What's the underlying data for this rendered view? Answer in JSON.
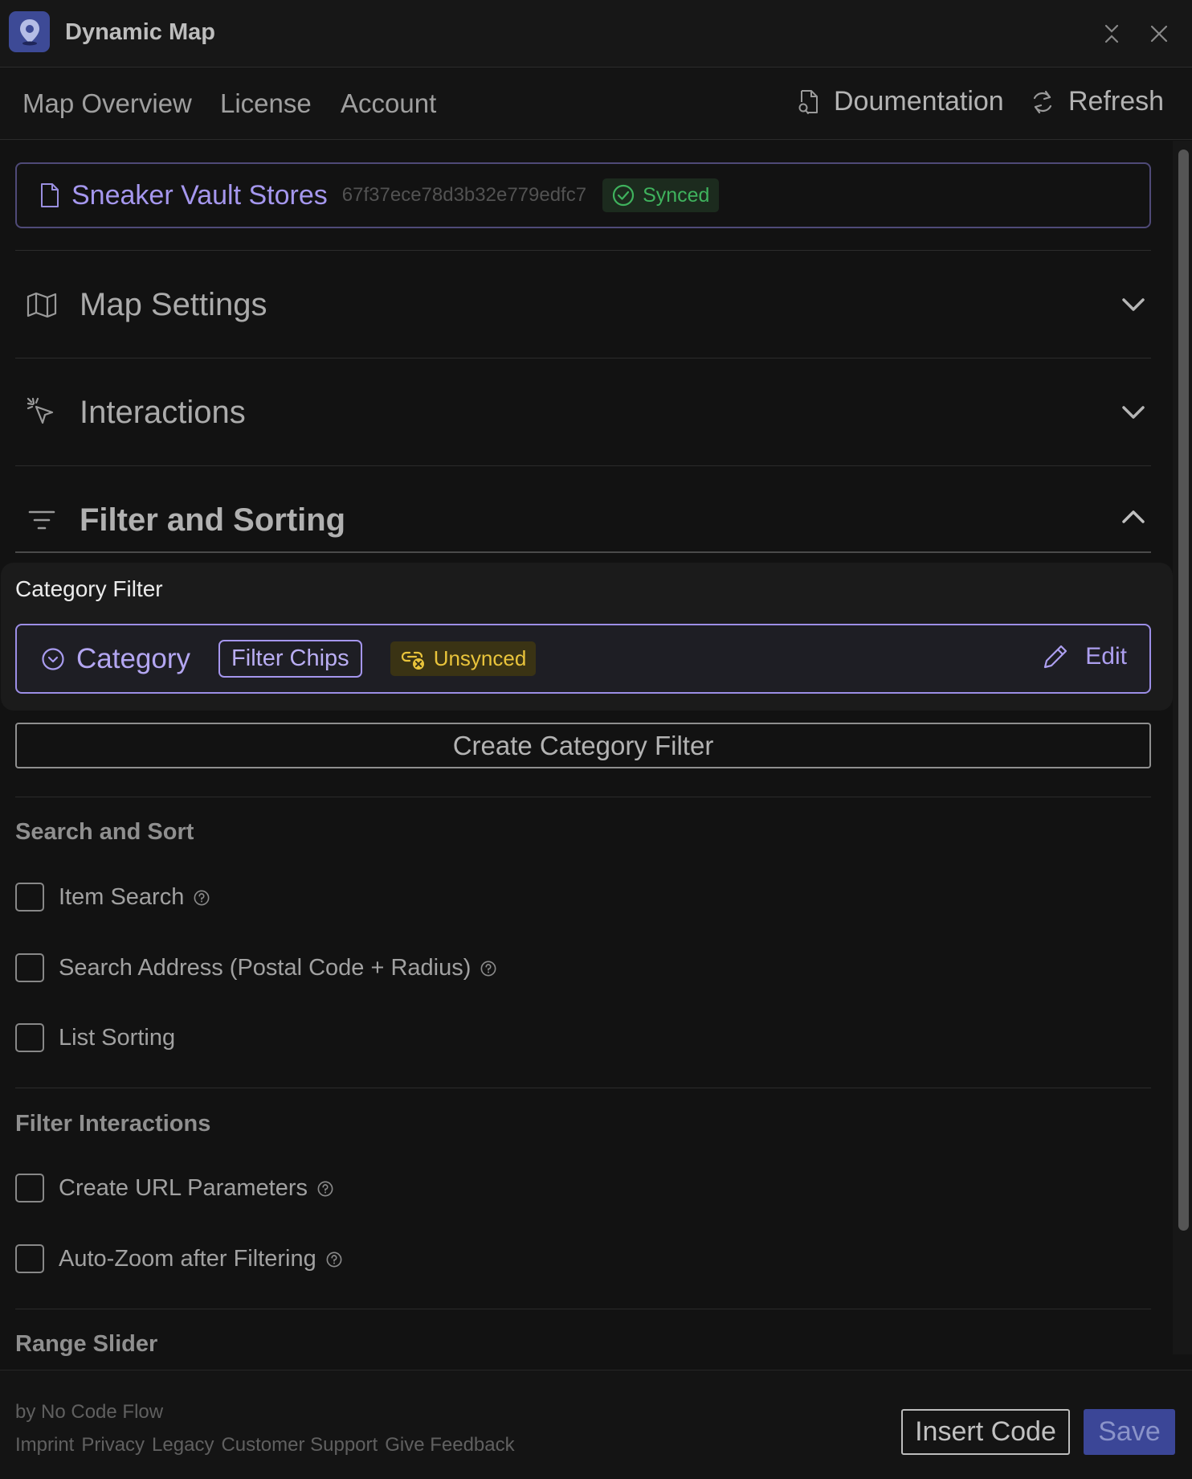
{
  "app": {
    "title": "Dynamic Map",
    "icon": "map-pin-icon",
    "accent_color": "#3d4a96"
  },
  "nav": {
    "tabs": [
      {
        "label": "Map Overview"
      },
      {
        "label": "License"
      },
      {
        "label": "Account"
      }
    ],
    "documentation_label": "Doumentation",
    "refresh_label": "Refresh"
  },
  "item": {
    "name": "Sneaker Vault Stores",
    "id": "67f37ece78d3b32e779edfc7",
    "status": "Synced",
    "status_color": "#3fb25d"
  },
  "accordions": {
    "map_settings": {
      "title": "Map Settings",
      "state": "collapsed"
    },
    "interactions": {
      "title": "Interactions",
      "state": "collapsed"
    },
    "filter_sorting": {
      "title": "Filter and Sorting",
      "state": "expanded"
    }
  },
  "category_filter": {
    "label": "Category Filter",
    "name": "Category",
    "type_chip": "Filter Chips",
    "status": "Unsynced",
    "status_color": "#e9c43b",
    "edit_label": "Edit",
    "create_button": "Create Category Filter"
  },
  "search_sort": {
    "title": "Search and Sort",
    "options": [
      {
        "label": "Item Search",
        "checked": false,
        "help": true
      },
      {
        "label": "Search Address (Postal Code + Radius)",
        "checked": false,
        "help": true
      },
      {
        "label": "List Sorting",
        "checked": false,
        "help": false
      }
    ]
  },
  "filter_interactions": {
    "title": "Filter Interactions",
    "options": [
      {
        "label": "Create URL Parameters",
        "checked": false,
        "help": true
      },
      {
        "label": "Auto-Zoom after Filtering",
        "checked": false,
        "help": true
      }
    ]
  },
  "range_slider": {
    "title": "Range Slider"
  },
  "footer": {
    "byline": "by No Code Flow",
    "links": [
      "Imprint",
      "Privacy",
      "Legacy",
      "Customer Support",
      "Give Feedback"
    ],
    "insert_code": "Insert Code",
    "save": "Save"
  }
}
